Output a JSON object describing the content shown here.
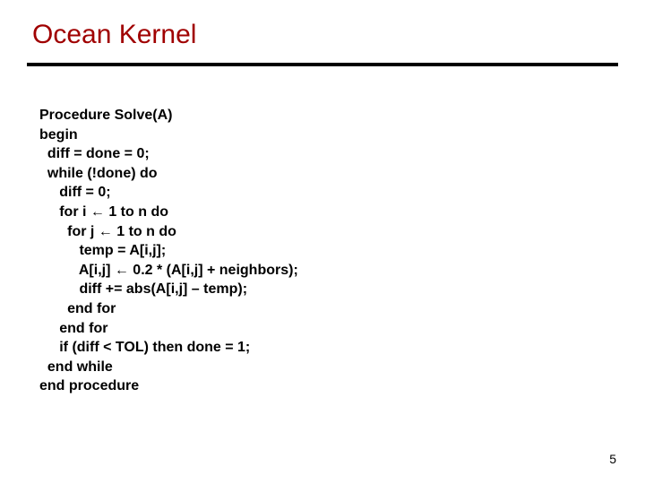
{
  "title": "Ocean Kernel",
  "page_number": "5",
  "code": {
    "l1": "Procedure Solve(A)",
    "l2": "begin",
    "l3": "  diff = done = 0;",
    "l4": "  while (!done) do",
    "l5": "     diff = 0;",
    "l6a": "     for i ",
    "l6b": " 1 to n do",
    "l7a": "       for j ",
    "l7b": " 1 to n do",
    "l8": "          temp = A[i,j];",
    "l9a": "          A[i,j] ",
    "l9b": " 0.2 * (A[i,j] + neighbors);",
    "l10": "          diff += abs(A[i,j] – temp);",
    "l11": "       end for",
    "l12": "     end for",
    "l13": "     if (diff < TOL) then done = 1;",
    "l14": "  end while",
    "l15": "end procedure",
    "arrow": "←"
  }
}
